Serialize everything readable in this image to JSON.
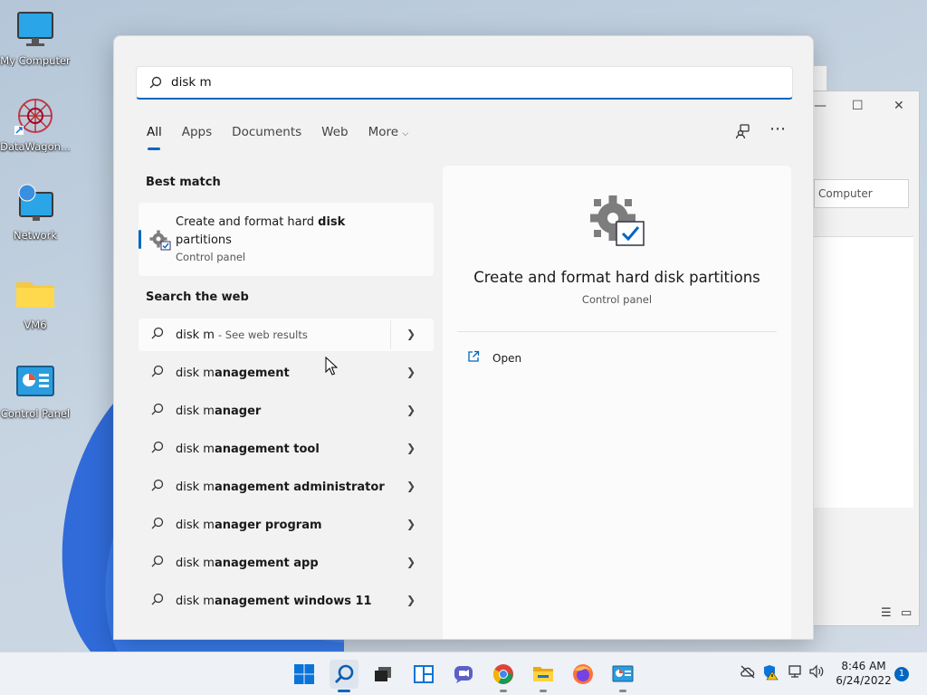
{
  "desktop": {
    "icons": [
      {
        "label": "My Computer",
        "icon": "monitor-icon"
      },
      {
        "label": "DataWagon...",
        "icon": "datawagon-icon"
      },
      {
        "label": "Network",
        "icon": "network-icon"
      },
      {
        "label": "VM6",
        "icon": "folder-icon"
      },
      {
        "label": "Control Panel",
        "icon": "control-panel-icon"
      }
    ]
  },
  "background_window": {
    "search_text": "Computer",
    "minimize": "—",
    "maximize": "☐",
    "close": "✕"
  },
  "search": {
    "query": "disk m",
    "tabs": [
      {
        "label": "All",
        "active": true
      },
      {
        "label": "Apps"
      },
      {
        "label": "Documents"
      },
      {
        "label": "Web"
      },
      {
        "label": "More"
      }
    ],
    "best_match": {
      "heading": "Best match",
      "title_pre": "Create and format hard ",
      "title_bold": "disk",
      "title_post": "partitions",
      "subtitle": "Control panel"
    },
    "web": {
      "heading": "Search the web",
      "first": {
        "query": "disk m",
        "suffix": "- See web results"
      },
      "suggestions": [
        {
          "pre": "disk m",
          "bold": "anagement"
        },
        {
          "pre": "disk m",
          "bold": "anager"
        },
        {
          "pre": "disk m",
          "bold": "anagement tool"
        },
        {
          "pre": "disk m",
          "bold": "anagement administrator"
        },
        {
          "pre": "disk m",
          "bold": "anager program"
        },
        {
          "pre": "disk m",
          "bold": "anagement app"
        },
        {
          "pre": "disk m",
          "bold": "anagement windows 11"
        }
      ]
    },
    "detail": {
      "title": "Create and format hard disk partitions",
      "subtitle": "Control panel",
      "open_label": "Open"
    }
  },
  "taskbar": {
    "apps": [
      "start-icon",
      "search-icon",
      "task-view-icon",
      "widgets-icon",
      "chat-icon",
      "chrome-icon",
      "file-explorer-icon",
      "firefox-icon",
      "control-panel-icon"
    ],
    "time": "8:46 AM",
    "date": "6/24/2022",
    "notifications": "1"
  },
  "colors": {
    "accent": "#0067c0"
  }
}
